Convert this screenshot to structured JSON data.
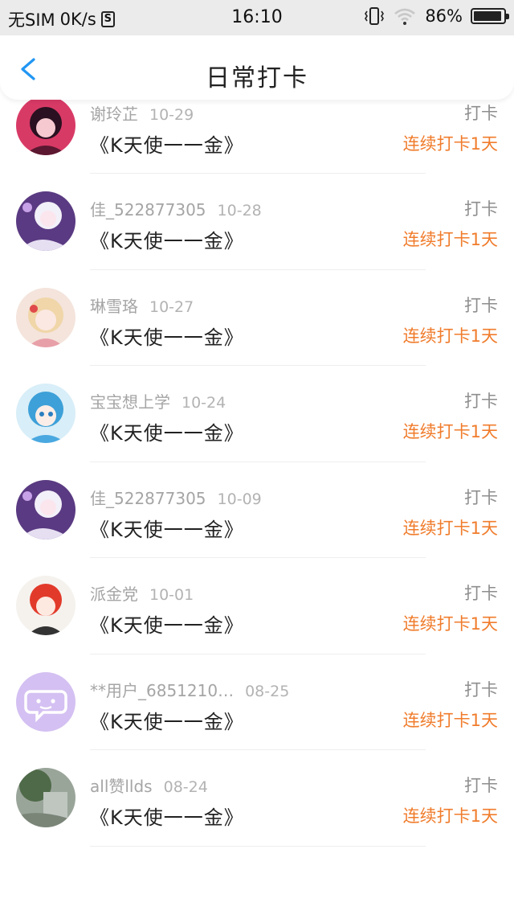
{
  "status_bar": {
    "carrier": "无SIM",
    "speed": "0K/s",
    "sim_icon_glyph": "S",
    "time": "16:10",
    "battery": "86%"
  },
  "nav": {
    "title": "日常打卡",
    "back_icon": "chevron-left-icon"
  },
  "colors": {
    "accent_blue": "#2196f3",
    "streak_orange": "#f07c2c"
  },
  "checkins": [
    {
      "name": "",
      "date": "",
      "book": "《K天使一一金》",
      "action": "",
      "streak": "连续打卡1天",
      "avatar": "pink"
    },
    {
      "name": "谢玲芷",
      "date": "10-29",
      "book": "《K天使一一金》",
      "action": "打卡",
      "streak": "连续打卡1天",
      "avatar": "red-dark"
    },
    {
      "name": "佳_522877305",
      "date": "10-28",
      "book": "《K天使一一金》",
      "action": "打卡",
      "streak": "连续打卡1天",
      "avatar": "purple"
    },
    {
      "name": "琳雪珞",
      "date": "10-27",
      "book": "《K天使一一金》",
      "action": "打卡",
      "streak": "连续打卡1天",
      "avatar": "blonde"
    },
    {
      "name": "宝宝想上学",
      "date": "10-24",
      "book": "《K天使一一金》",
      "action": "打卡",
      "streak": "连续打卡1天",
      "avatar": "blue"
    },
    {
      "name": "佳_522877305",
      "date": "10-09",
      "book": "《K天使一一金》",
      "action": "打卡",
      "streak": "连续打卡1天",
      "avatar": "purple"
    },
    {
      "name": "派金党",
      "date": "10-01",
      "book": "《K天使一一金》",
      "action": "打卡",
      "streak": "连续打卡1天",
      "avatar": "redhair"
    },
    {
      "name": "**用户_6851210…",
      "date": "08-25",
      "book": "《K天使一一金》",
      "action": "打卡",
      "streak": "连续打卡1天",
      "avatar": "default"
    },
    {
      "name": "all赞llds",
      "date": "08-24",
      "book": "《K天使一一金》",
      "action": "打卡",
      "streak": "连续打卡1天",
      "avatar": "green"
    }
  ]
}
